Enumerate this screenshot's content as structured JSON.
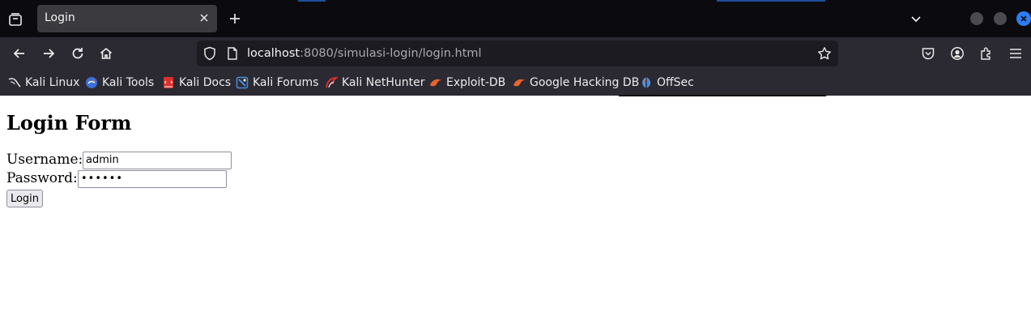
{
  "tab": {
    "title": "Login"
  },
  "url": {
    "host": "localhost",
    "rest": ":8080/simulasi-login/login.html"
  },
  "bookmarks": [
    {
      "label": "Kali Linux",
      "icon": "kali-dragon-icon",
      "color": "#dddddd"
    },
    {
      "label": "Kali Tools",
      "icon": "kali-tools-icon",
      "color": "#3b6fd6"
    },
    {
      "label": "Kali Docs",
      "icon": "kali-docs-icon",
      "color": "#d9302c"
    },
    {
      "label": "Kali Forums",
      "icon": "kali-forums-icon",
      "color": "#4a8fe0"
    },
    {
      "label": "Kali NetHunter",
      "icon": "nethunter-icon",
      "color": "#d9302c"
    },
    {
      "label": "Exploit-DB",
      "icon": "exploit-db-icon",
      "color": "#e8642c"
    },
    {
      "label": "Google Hacking DB",
      "icon": "ghdb-icon",
      "color": "#e8642c"
    },
    {
      "label": "OffSec",
      "icon": "offsec-icon",
      "color": "#4a8fe0"
    }
  ],
  "page": {
    "title": "Login Form",
    "username_label": "Username:",
    "username_value": "admin",
    "password_label": "Password:",
    "password_value": "••••••",
    "login_label": "Login"
  },
  "colors": {
    "tabbar": "#0b0b0f",
    "toolbar": "#2b2a33",
    "urlbar": "#1c1b22",
    "accent": "#2d7df6"
  }
}
